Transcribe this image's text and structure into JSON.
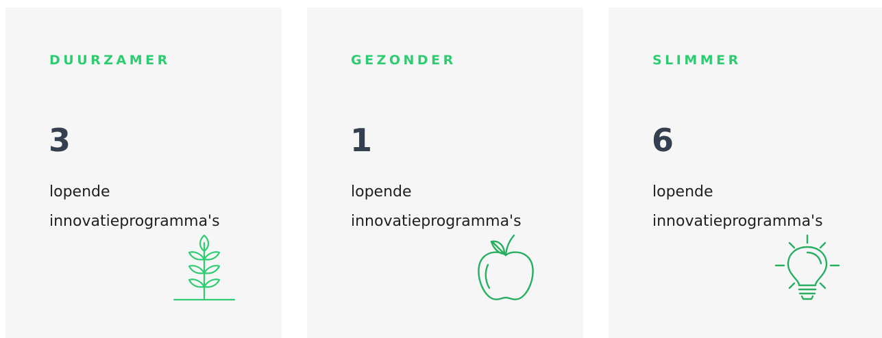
{
  "cards": [
    {
      "category": "DUURZAMER",
      "count": "3",
      "line1": "lopende",
      "line2": "innovatieprogramma's",
      "icon": "wheat-icon"
    },
    {
      "category": "GEZONDER",
      "count": "1",
      "line1": "lopende",
      "line2": "innovatieprogramma's",
      "icon": "apple-icon"
    },
    {
      "category": "SLIMMER",
      "count": "6",
      "line1": "lopende",
      "line2": "innovatieprogramma's",
      "icon": "lightbulb-icon"
    }
  ],
  "colors": {
    "accent": "#2ecc71",
    "icon_green": "#27ae60",
    "number": "#34404f",
    "card_bg": "#f6f6f6"
  }
}
